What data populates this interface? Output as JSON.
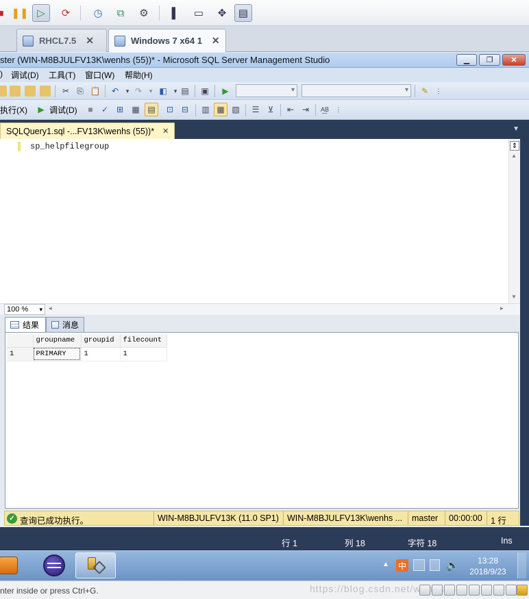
{
  "vm_tabs": [
    {
      "label": "RHCL7.5",
      "close": "✕"
    },
    {
      "label": "Windows 7 x64 1",
      "close": "✕"
    }
  ],
  "window": {
    "title": "ster (WIN-M8BJULFV13K\\wenhs (55))* - Microsoft SQL Server Management Studio"
  },
  "menu": [
    ")",
    "调试(D)",
    "工具(T)",
    "窗口(W)",
    "帮助(H)"
  ],
  "toolbar2": {
    "execute_label": "执行(X)",
    "debug_label": "调试(D)"
  },
  "document_tab": {
    "label": "SQLQuery1.sql -...FV13K\\wenhs (55))*",
    "close": "✕"
  },
  "editor": {
    "code": "sp_helpfilegroup"
  },
  "zoom": {
    "value": "100 %"
  },
  "results_tabs": [
    {
      "label": "结果"
    },
    {
      "label": "消息"
    }
  ],
  "results_grid": {
    "columns": [
      "groupname",
      "groupid",
      "filecount"
    ],
    "rows": [
      {
        "rownum": "1",
        "cells": [
          "PRIMARY",
          "1",
          "1"
        ]
      }
    ]
  },
  "status": {
    "message": "查询已成功执行。",
    "server": "WIN-M8BJULFV13K (11.0 SP1)",
    "user": "WIN-M8BJULFV13K\\wenhs ...",
    "database": "master",
    "elapsed": "00:00:00",
    "rows": "1 行"
  },
  "position": {
    "line": "行 1",
    "col": "列 18",
    "ch": "字符 18",
    "mode": "Ins"
  },
  "taskbar": {
    "time": "13:28",
    "date": "2018/9/23"
  },
  "vm_status": {
    "hint": "nter inside or press Ctrl+G.",
    "watermark": "https://blog.csdn.net/wenhs5479"
  }
}
